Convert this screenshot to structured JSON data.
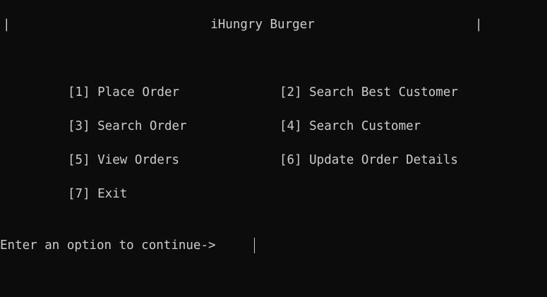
{
  "header": {
    "rule": "------------------------------------------------------------------------------------------",
    "left_pipe": "|",
    "right_pipe": "|",
    "title": "iHungry Burger"
  },
  "menu": {
    "items": [
      {
        "label": "[1] Place Order"
      },
      {
        "label": "[2] Search Best Customer"
      },
      {
        "label": "[3] Search Order"
      },
      {
        "label": "[4] Search Customer"
      },
      {
        "label": "[5] View Orders"
      },
      {
        "label": "[6] Update Order Details"
      },
      {
        "label": "[7] Exit"
      }
    ]
  },
  "prompt": {
    "text": "Enter an option to continue-> "
  },
  "colors": {
    "background": "#0c0c0c",
    "foreground": "#cccccc"
  }
}
